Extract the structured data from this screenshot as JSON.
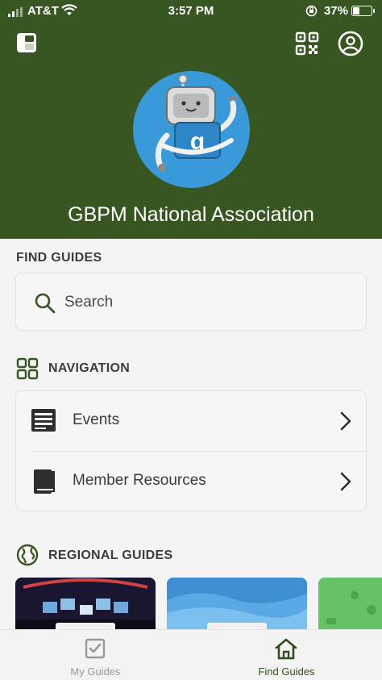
{
  "status_bar": {
    "carrier": "AT&T",
    "time": "3:57 PM",
    "battery": "37%"
  },
  "header": {
    "org_name": "GBPM National Association",
    "background_color": "#375622",
    "logo_icon": "robot-mascot-icon",
    "left_icon": "layout-panels-icon",
    "right_icons": [
      "qr-code-icon",
      "account-icon"
    ]
  },
  "find_guides": {
    "title": "FIND GUIDES",
    "search_placeholder": "Search"
  },
  "navigation": {
    "title": "NAVIGATION",
    "items": [
      {
        "label": "Events",
        "icon": "events-list-icon"
      },
      {
        "label": "Member Resources",
        "icon": "book-icon"
      }
    ]
  },
  "regional_guides": {
    "title": "REGIONAL GUIDES",
    "icon": "globe-icon"
  },
  "tab_bar": {
    "tabs": [
      {
        "label": "My Guides",
        "icon": "checkbox-icon",
        "active": false
      },
      {
        "label": "Find Guides",
        "icon": "home-icon",
        "active": true
      }
    ],
    "active_color": "#2f4d1e",
    "inactive_color": "#9a9a9a"
  }
}
